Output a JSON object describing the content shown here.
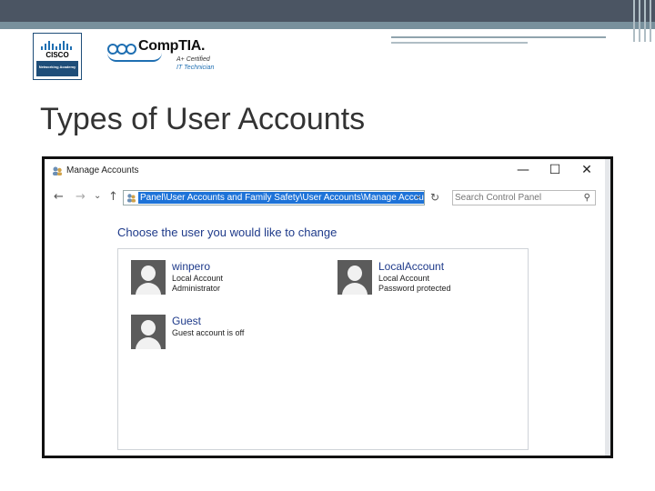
{
  "logos": {
    "cisco_word": "CISCO",
    "cisco_band": "Networking Academy",
    "comptia_brand": "CompTIA.",
    "comptia_cert_line1": "A+ Certified",
    "comptia_cert_line2": "IT Technician"
  },
  "slide": {
    "title": "Types of User Accounts"
  },
  "window": {
    "title": "Manage Accounts",
    "controls": {
      "minimize": "—",
      "maximize": "☐",
      "close": "✕"
    },
    "nav": {
      "back": "←",
      "forward": "→",
      "recent": "⌄",
      "up": "↑",
      "refresh": "↻"
    },
    "address_path": "Panel\\User Accounts and Family Safety\\User Accounts\\Manage Accounts",
    "address_dropdown": "⌄",
    "search_placeholder": "Search Control Panel",
    "search_icon": "⚲",
    "heading": "Choose the user you would like to change",
    "accounts": [
      {
        "name": "winpero",
        "line1": "Local Account",
        "line2": "Administrator"
      },
      {
        "name": "LocalAccount",
        "line1": "Local Account",
        "line2": "Password protected"
      },
      {
        "name": "Guest",
        "line1": "Guest account is off",
        "line2": ""
      }
    ]
  },
  "colors": {
    "accent": "#1e73d8",
    "link": "#1e3a8a",
    "slide_band": "#4b5563"
  }
}
